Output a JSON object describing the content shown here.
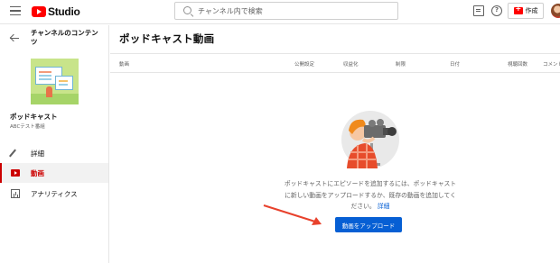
{
  "app": {
    "logo_text": "Studio",
    "logo_color": "#ff0000"
  },
  "search": {
    "placeholder": "チャンネル内で検索"
  },
  "topbar": {
    "create_label": "作成",
    "help_glyph": "?"
  },
  "sidebar": {
    "channel_title": "チャンネルのコンテンツ",
    "podcast_name": "ポッドキャスト",
    "podcast_subtitle": "ABCテスト番組",
    "items": [
      {
        "label": "詳細",
        "icon": "pencil-icon",
        "active": false
      },
      {
        "label": "動画",
        "icon": "video-icon",
        "active": true
      },
      {
        "label": "アナリティクス",
        "icon": "chart-icon",
        "active": false
      }
    ]
  },
  "main": {
    "title": "ポッドキャスト動画",
    "columns": [
      "動画",
      "公開設定",
      "収益化",
      "制限",
      "日付",
      "視聴回数",
      "コメント"
    ],
    "empty_message": "ポッドキャストにエピソードを追加するには、ポッドキャストに新しい動画をアップロードするか、既存の動画を追加してください。",
    "details_link": "詳細",
    "upload_button": "動画をアップロード"
  },
  "colors": {
    "accent": "#065fd4",
    "active": "#cc0000",
    "annotation_arrow": "#e8412c"
  }
}
